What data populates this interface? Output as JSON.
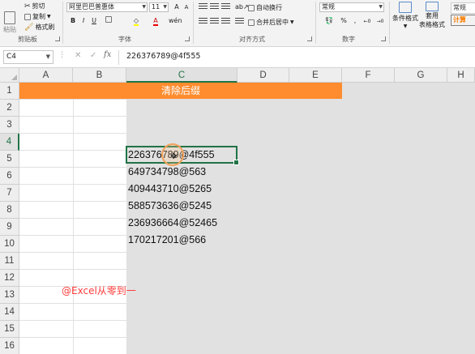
{
  "ribbon": {
    "clipboard": {
      "paste": "粘贴",
      "cut": "剪切",
      "copy": "复制",
      "format_painter": "格式刷",
      "label": "剪贴板"
    },
    "font": {
      "name": "阿里巴巴普惠体",
      "size": "11",
      "bold": "B",
      "italic": "I",
      "underline": "U",
      "grow": "A",
      "shrink": "A",
      "label": "字体"
    },
    "alignment": {
      "wrap": "自动换行",
      "merge": "合并后居中",
      "label": "对齐方式"
    },
    "number": {
      "format": "常规",
      "percent": "%",
      "comma": ",",
      "label": "数字"
    },
    "styles": {
      "conditional": "条件格式",
      "table": "套用",
      "table2": "表格格式",
      "style_normal": "常规",
      "style_calc": "计算",
      "calc_color": "#f2a33a"
    }
  },
  "formula_bar": {
    "name_box": "C4",
    "fx": "fx",
    "content": "226376789@4f555"
  },
  "columns": [
    "A",
    "B",
    "C",
    "D",
    "E",
    "F",
    "G",
    "H"
  ],
  "rows": [
    "1",
    "2",
    "3",
    "4",
    "5",
    "6",
    "7",
    "8",
    "9",
    "10",
    "11",
    "12",
    "13",
    "14",
    "15",
    "16"
  ],
  "sheet": {
    "title": "清除后缀",
    "title_color": "#ff8c2e",
    "data": [
      "226376789@4f555",
      "649734798@563",
      "409443710@5265",
      "588573636@5245",
      "236936664@52465",
      "170217201@566"
    ],
    "credit": "@Excel从零到一",
    "credit_color": "#ff3b3b",
    "selection_color": "#217346"
  }
}
